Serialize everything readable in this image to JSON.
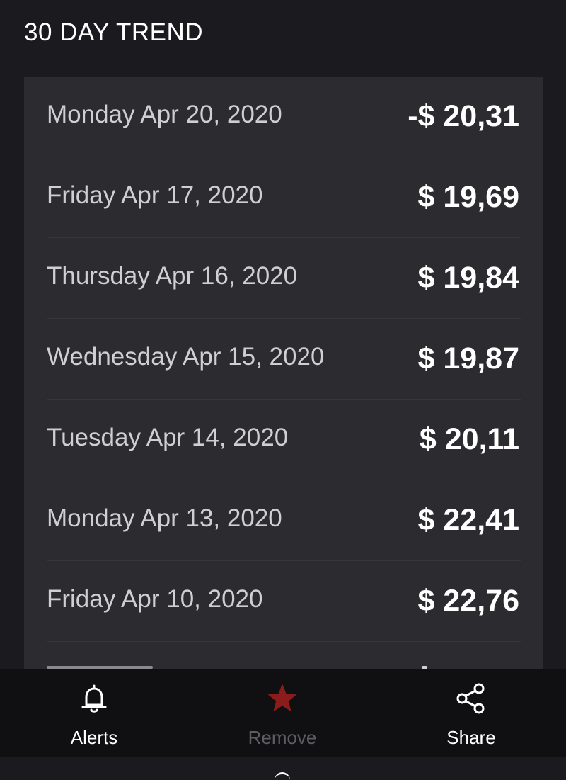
{
  "header": {
    "title": "30 DAY TREND"
  },
  "trend": {
    "rows": [
      {
        "date": "Monday Apr 20, 2020",
        "price": "-$ 20,31"
      },
      {
        "date": "Friday Apr 17, 2020",
        "price": "$ 19,69"
      },
      {
        "date": "Thursday Apr 16, 2020",
        "price": "$ 19,84"
      },
      {
        "date": "Wednesday Apr 15, 2020",
        "price": "$ 19,87"
      },
      {
        "date": "Tuesday Apr 14, 2020",
        "price": "$ 20,11"
      },
      {
        "date": "Monday Apr 13, 2020",
        "price": "$ 22,41"
      },
      {
        "date": "Friday Apr 10, 2020",
        "price": "$ 22,76"
      }
    ]
  },
  "bottom_nav": {
    "alerts": {
      "label": "Alerts",
      "icon": "bell-icon"
    },
    "remove": {
      "label": "Remove",
      "icon": "star-icon",
      "icon_color": "#8c1c1c"
    },
    "share": {
      "label": "Share",
      "icon": "share-icon"
    }
  },
  "colors": {
    "background": "#1b1b1f",
    "panel": "#2b2b30",
    "nav_background": "#101012",
    "text_primary": "#ffffff",
    "text_secondary": "#cfcfd2",
    "text_disabled": "#5e5e62",
    "accent_star": "#8c1c1c"
  }
}
